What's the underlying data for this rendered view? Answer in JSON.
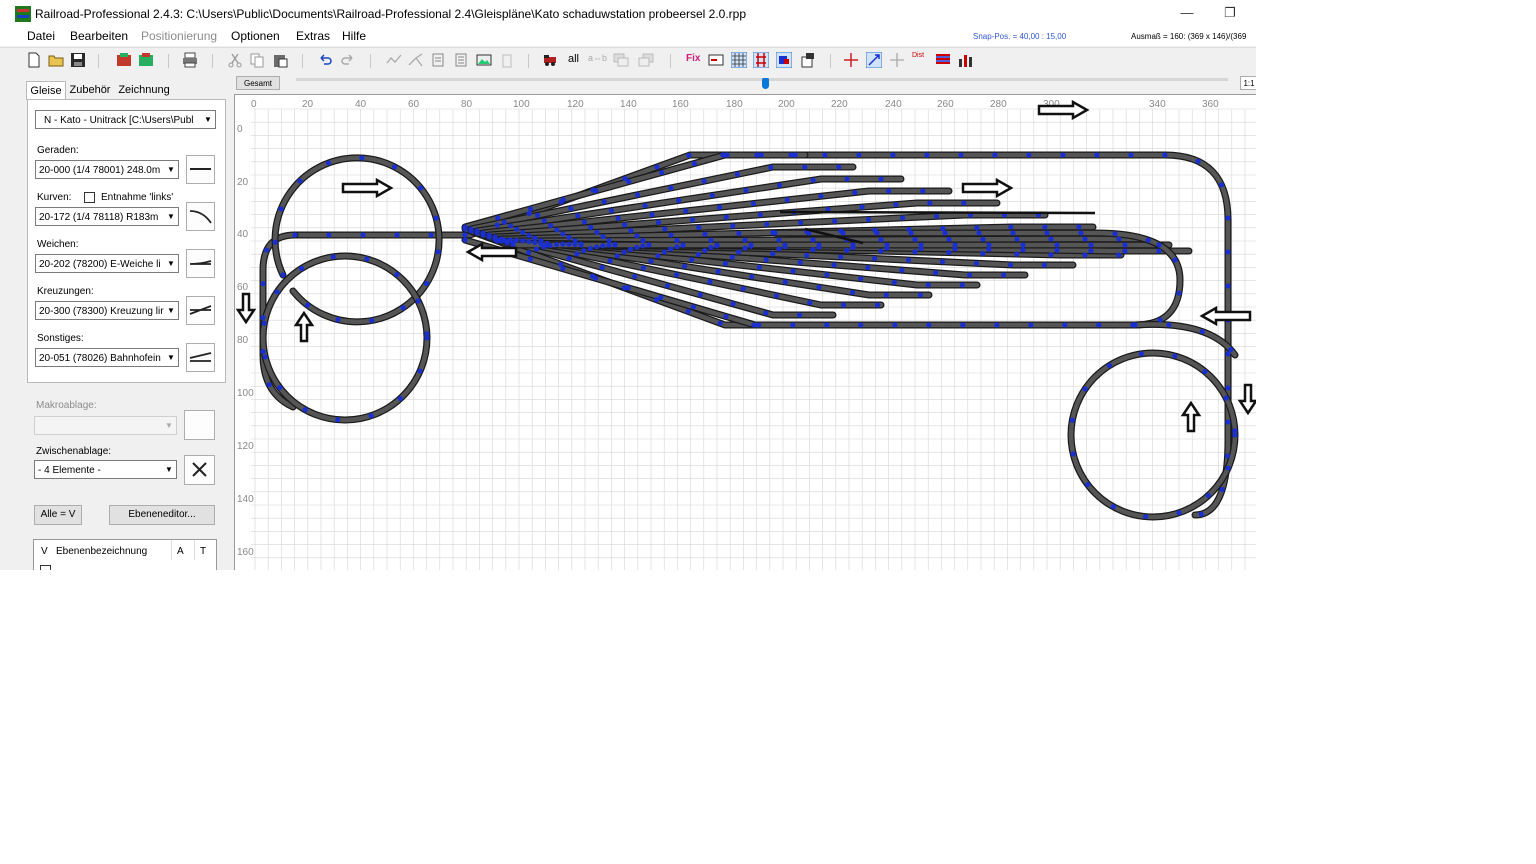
{
  "window": {
    "title": "Railroad-Professional 2.4.3:  C:\\Users\\Public\\Documents\\Railroad-Professional 2.4\\Gleispläne\\Kato schaduwstation probeersel 2.0.rpp",
    "minimize": "—",
    "restore": "❐"
  },
  "menu": [
    "Datei",
    "Bearbeiten",
    "Positionierung",
    "Optionen",
    "Extras",
    "Hilfe"
  ],
  "status": {
    "snap": "Snap-Pos. = 40,00 : 15,00",
    "ausmass": "Ausmaß = 160: (369 x 146)/(369"
  },
  "toolbar": {
    "all_label": "all",
    "ab_label": "a⇔b",
    "fix_label": "Fix",
    "dist_label": "Dist"
  },
  "tabs": [
    "Gleise",
    "Zubehör",
    "Zeichnung"
  ],
  "library": "N - Kato - Unitrack  [C:\\Users\\Publ",
  "fields": {
    "geraden_label": "Geraden:",
    "geraden_value": "20-000 (1/4 78001) 248.0m",
    "kurven_label": "Kurven:",
    "entnahme_label": "Entnahme 'links'",
    "kurven_value": "20-172 (1/4 78118) R183m",
    "weichen_label": "Weichen:",
    "weichen_value": "20-202 (78200) E-Weiche li",
    "kreuzungen_label": "Kreuzungen:",
    "kreuzungen_value": "20-300 (78300) Kreuzung lir",
    "sonstiges_label": "Sonstiges:",
    "sonstiges_value": "20-051 (78026) Bahnhofein"
  },
  "makro_label": "Makroablage:",
  "zwischen_label": "Zwischenablage:",
  "zwischen_value": "- 4 Elemente -",
  "alle_btn": "Alle = V",
  "ebenen_btn": "Ebeneneditor...",
  "layer_header": {
    "v": "V",
    "name": "Ebenenbezeichnung",
    "a": "A",
    "t": "T"
  },
  "canvas": {
    "gesamt": "Gesamt",
    "zoom_label": "1:1",
    "x_ticks": [
      "0",
      "20",
      "40",
      "60",
      "80",
      "100",
      "120",
      "140",
      "160",
      "180",
      "200",
      "220",
      "240",
      "260",
      "280",
      "300",
      "340",
      "360"
    ],
    "y_ticks": [
      "0",
      "20",
      "40",
      "60",
      "80",
      "100",
      "120",
      "140",
      "160"
    ]
  },
  "colors": {
    "track": "#555555",
    "track_dark": "#1a1a1a",
    "connector": "#1a2fd0",
    "grid": "#d6d6d6"
  }
}
